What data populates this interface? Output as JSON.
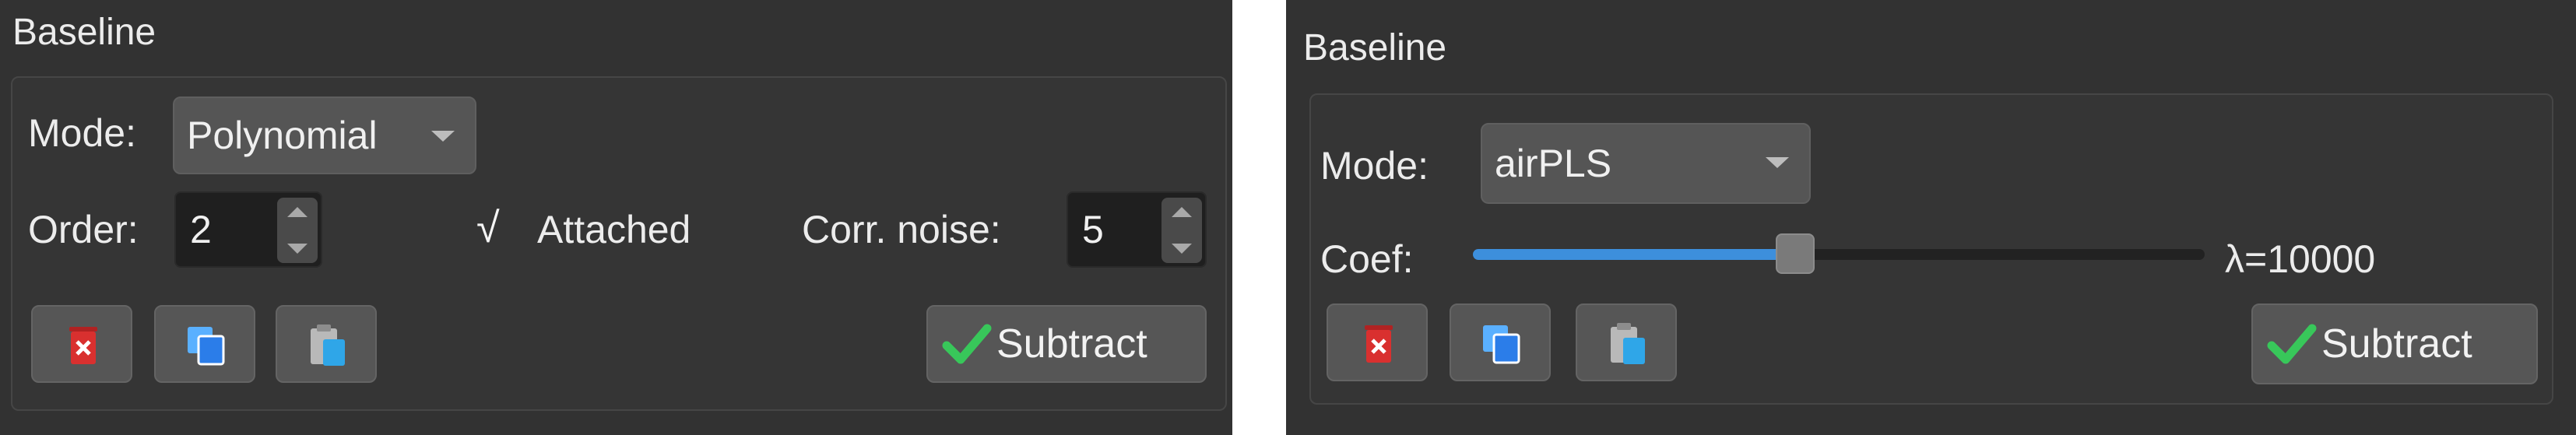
{
  "left_panel": {
    "group_title": "Baseline",
    "mode": {
      "label": "Mode:",
      "value": "Polynomial"
    },
    "order": {
      "label": "Order:",
      "value": "2"
    },
    "attached": {
      "check": "√",
      "label": "Attached",
      "checked": true
    },
    "corr_noise": {
      "label": "Corr. noise:",
      "value": "5"
    },
    "buttons": {
      "delete_icon": "delete-icon",
      "copy_icon": "copy-icon",
      "paste_icon": "paste-icon",
      "subtract_label": "Subtract"
    }
  },
  "right_panel": {
    "group_title": "Baseline",
    "mode": {
      "label": "Mode:",
      "value": "airPLS"
    },
    "coef": {
      "label": "Coef:",
      "value_text": "λ=10000",
      "slider_fraction": 0.44
    },
    "buttons": {
      "delete_icon": "delete-icon",
      "copy_icon": "copy-icon",
      "paste_icon": "paste-icon",
      "subtract_label": "Subtract"
    }
  },
  "colors": {
    "panel_bg": "#323232",
    "slider_accent": "#3d8fdc",
    "check_green": "#38c75a",
    "delete_red": "#d9302f",
    "copy_blue": "#2b7de9"
  }
}
